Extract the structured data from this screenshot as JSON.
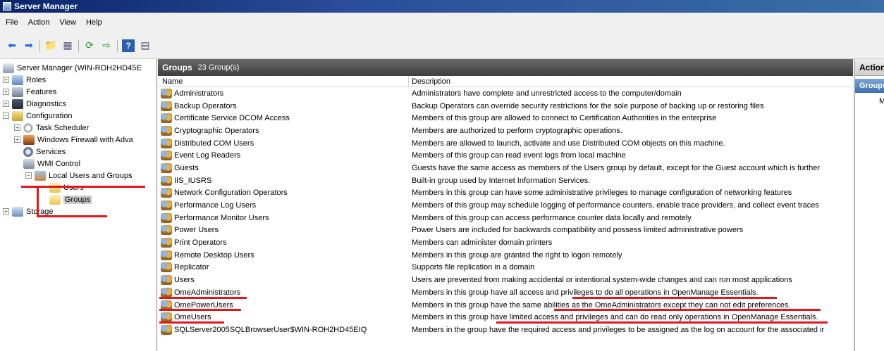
{
  "window": {
    "title": "Server Manager"
  },
  "menu": [
    "File",
    "Action",
    "View",
    "Help"
  ],
  "toolbar_icons": [
    "back-arrow-icon",
    "forward-arrow-icon",
    "up-folder-icon",
    "show-hide-tree-icon",
    "refresh-icon",
    "export-list-icon",
    "help-icon",
    "action-pane-icon"
  ],
  "tree": {
    "root": "Server Manager (WIN-ROH2HD45E",
    "roles": "Roles",
    "features": "Features",
    "diagnostics": "Diagnostics",
    "configuration": "Configuration",
    "task_scheduler": "Task Scheduler",
    "firewall": "Windows Firewall with Adva",
    "services": "Services",
    "wmi": "WMI Control",
    "local_users": "Local Users and Groups",
    "users": "Users",
    "groups": "Groups",
    "storage": "Storage"
  },
  "main": {
    "title": "Groups",
    "count": "23 Group(s)",
    "columns": {
      "name": "Name",
      "description": "Description"
    },
    "rows": [
      {
        "name": "Administrators",
        "desc": "Administrators have complete and unrestricted access to the computer/domain"
      },
      {
        "name": "Backup Operators",
        "desc": "Backup Operators can override security restrictions for the sole purpose of backing up or restoring files"
      },
      {
        "name": "Certificate Service DCOM Access",
        "desc": "Members of this group are allowed to connect to Certification Authorities in the enterprise"
      },
      {
        "name": "Cryptographic Operators",
        "desc": "Members are authorized to perform cryptographic operations."
      },
      {
        "name": "Distributed COM Users",
        "desc": "Members are allowed to launch, activate and use Distributed COM objects on this machine."
      },
      {
        "name": "Event Log Readers",
        "desc": "Members of this group can read event logs from local machine"
      },
      {
        "name": "Guests",
        "desc": "Guests have the same access as members of the Users group by default, except for the Guest account which is further"
      },
      {
        "name": "IIS_IUSRS",
        "desc": "Built-in group used by Internet Information Services."
      },
      {
        "name": "Network Configuration Operators",
        "desc": "Members in this group can have some administrative privileges to manage configuration of networking features"
      },
      {
        "name": "Performance Log Users",
        "desc": "Members of this group may schedule logging of performance counters, enable trace providers, and collect event traces"
      },
      {
        "name": "Performance Monitor Users",
        "desc": "Members of this group can access performance counter data locally and remotely"
      },
      {
        "name": "Power Users",
        "desc": "Power Users are included for backwards compatibility and possess limited administrative powers"
      },
      {
        "name": "Print Operators",
        "desc": "Members can administer domain printers"
      },
      {
        "name": "Remote Desktop Users",
        "desc": "Members in this group are granted the right to logon remotely"
      },
      {
        "name": "Replicator",
        "desc": "Supports file replication in a domain"
      },
      {
        "name": "Users",
        "desc": "Users are prevented from making accidental or intentional system-wide changes and can run most applications"
      },
      {
        "name": "OmeAdministrators",
        "desc": "Members in this group have all access and privileges to do all operations in OpenManage Essentials."
      },
      {
        "name": "OmePowerUsers",
        "desc": "Members in this group have the same abilities as the OmeAdministrators except they can not edit preferences."
      },
      {
        "name": "OmeUsers",
        "desc": "Members in this group have limited access and privileges and can do read only operations in OpenManage Essentials."
      },
      {
        "name": "SQLServer2005SQLBrowserUser$WIN-ROH2HD45EIQ",
        "desc": "Members in the group have the required access and privileges to be assigned as the log on account for the associated ir"
      }
    ]
  },
  "actions": {
    "title": "Actions",
    "section": "Groups",
    "item": "More Actions"
  },
  "colors": {
    "highlight_underline": "#e8141c",
    "title_bar": "#0a246a"
  }
}
